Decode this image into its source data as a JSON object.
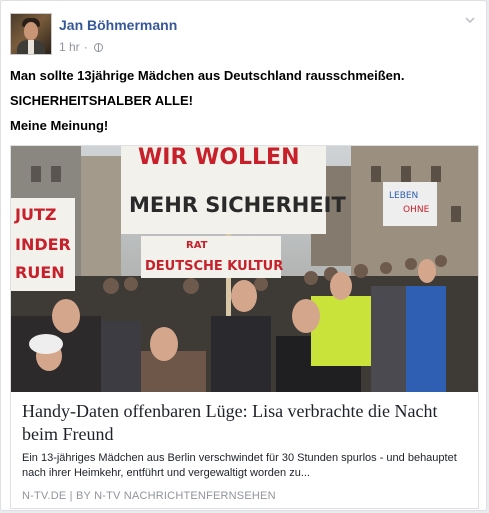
{
  "post": {
    "author": "Jan Böhmermann",
    "timestamp": "1 hr",
    "separator": "·",
    "privacy_icon": "globe-icon",
    "options_icon": "chevron-down-icon",
    "paragraphs": [
      "Man sollte 13jährige Mädchen aus Deutschland rausschmeißen.",
      "SICHERHEITSHALBER ALLE!",
      "Meine Meinung!"
    ]
  },
  "link": {
    "image": {
      "sign_main_line1": "WIR WOLLEN",
      "sign_main_line2": "MEHR SICHERHEIT",
      "sign_left_line1": "JUTZ",
      "sign_left_line2": "INDER",
      "sign_left_line3": "RUEN",
      "sign_mid_line1": "RAT",
      "sign_mid_line2": "DEUTSCHE KULTUR",
      "sign_right_line1": "LEBEN",
      "sign_right_line2": "OHNE"
    },
    "title": "Handy-Daten offenbaren Lüge: Lisa verbrachte die Nacht beim Freund",
    "description": "Ein 13-jähriges Mädchen aus Berlin verschwindet für 30 Stunden spurlos - und behauptet nach ihrer Heimkehr, entführt und vergewaltigt worden zu...",
    "source": "N-TV.DE | BY N-TV NACHRICHTENFERNSEHEN"
  },
  "colors": {
    "author_link": "#365899",
    "meta_gray": "#90949c",
    "sign_red": "#c8202a"
  }
}
